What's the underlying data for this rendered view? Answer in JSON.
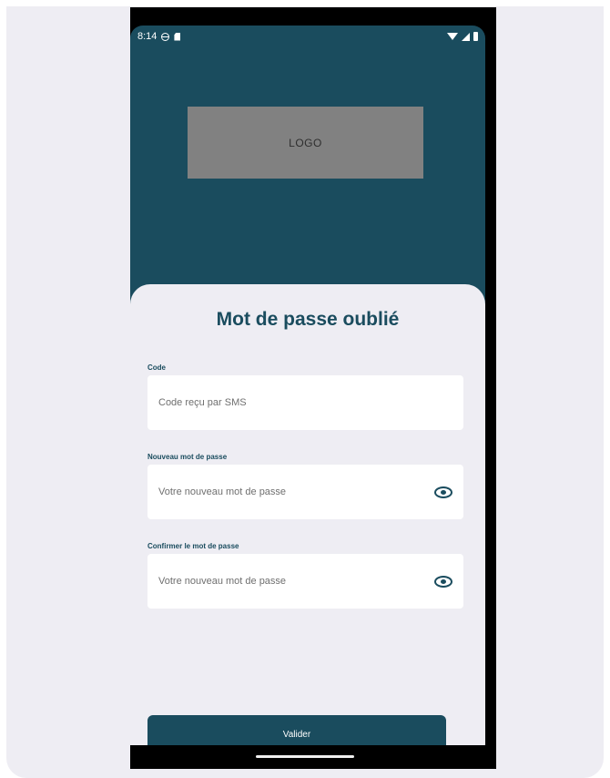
{
  "status_bar": {
    "time": "8:14",
    "icons": [
      "globe-icon",
      "sim-card-icon",
      "wifi-icon",
      "signal-icon",
      "battery-icon"
    ]
  },
  "logo": {
    "text": "LOGO"
  },
  "form": {
    "title": "Mot de passe oublié",
    "fields": [
      {
        "label": "Code",
        "placeholder": "Code reçu par SMS",
        "has_eye": false
      },
      {
        "label": "Nouveau mot de passe",
        "placeholder": "Votre nouveau mot de passe",
        "has_eye": true
      },
      {
        "label": "Confirmer le mot de passe",
        "placeholder": "Votre nouveau mot de passe",
        "has_eye": true
      }
    ],
    "submit_label": "Valider"
  },
  "colors": {
    "primary": "#1a4c5e",
    "sheet_background": "#eeedf3",
    "logo_placeholder": "#818181"
  }
}
